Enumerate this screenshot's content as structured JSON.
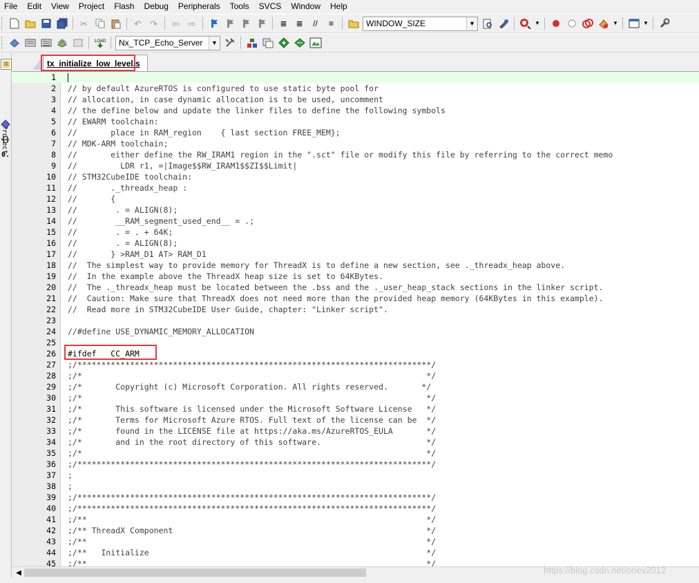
{
  "menu": [
    "File",
    "Edit",
    "View",
    "Project",
    "Flash",
    "Debug",
    "Peripherals",
    "Tools",
    "SVCS",
    "Window",
    "Help"
  ],
  "toolbar1": {
    "icons": [
      "new-file-icon",
      "open-folder-icon",
      "save-icon",
      "save-all-icon",
      "cut-icon",
      "copy-icon",
      "paste-icon",
      "undo-icon",
      "redo-icon",
      "nav-back-icon",
      "nav-forward-icon",
      "bookmark-icon",
      "bookmark-prev-icon",
      "bookmark-next-icon",
      "bookmark-clear-icon",
      "indent-icon",
      "unindent-icon",
      "comment-icon",
      "uncomment-icon",
      "find-in-files-icon"
    ],
    "find_combo_value": "WINDOW_SIZE",
    "icons_after": [
      "find-icon",
      "replace-icon",
      "debug-session-icon",
      "breakpoint-icon",
      "breakpoint-disabled-icon",
      "breakpoint-kill-icon",
      "breakpoint-options-icon",
      "window-layout-icon",
      "settings-wrench-icon"
    ]
  },
  "toolbar2": {
    "icons": [
      "translate-icon",
      "build-icon",
      "rebuild-icon",
      "batch-build-icon",
      "stop-build-icon",
      "download-icon"
    ],
    "target_combo_value": "Nx_TCP_Echo_Server",
    "icons_after": [
      "target-options-icon",
      "manage-components-icon",
      "select-packs-icon",
      "pack-installer-icon",
      "run-time-env-icon",
      "event-recorder-icon"
    ]
  },
  "leftpanel": {
    "label": "Project"
  },
  "tab": {
    "label": "tx_initialize_low_level.s"
  },
  "editor": {
    "lines": [
      {
        "n": "1",
        "t": ""
      },
      {
        "n": "2",
        "t": "// by default AzureRTOS is configured to use static byte pool for"
      },
      {
        "n": "3",
        "t": "// allocation, in case dynamic allocation is to be used, uncomment"
      },
      {
        "n": "4",
        "t": "// the define below and update the linker files to define the following symbols"
      },
      {
        "n": "5",
        "t": "// EWARM toolchain:"
      },
      {
        "n": "6",
        "t": "//       place in RAM_region    { last section FREE_MEM};"
      },
      {
        "n": "7",
        "t": "// MDK-ARM toolchain;"
      },
      {
        "n": "8",
        "t": "//       either define the RW_IRAM1 region in the \".sct\" file or modify this file by referring to the correct memo"
      },
      {
        "n": "9",
        "t": "//         LDR r1, =|Image$$RW_IRAM1$$ZI$$Limit|"
      },
      {
        "n": "10",
        "t": "// STM32CubeIDE toolchain:"
      },
      {
        "n": "11",
        "t": "//       ._threadx_heap :"
      },
      {
        "n": "12",
        "t": "//       {"
      },
      {
        "n": "13",
        "t": "//        . = ALIGN(8);"
      },
      {
        "n": "14",
        "t": "//        __RAM_segment_used_end__ = .;"
      },
      {
        "n": "15",
        "t": "//        . = . + 64K;"
      },
      {
        "n": "16",
        "t": "//        . = ALIGN(8);"
      },
      {
        "n": "17",
        "t": "//       } >RAM_D1 AT> RAM_D1"
      },
      {
        "n": "18",
        "t": "//  The simplest way to provide memory for ThreadX is to define a new section, see ._threadx_heap above."
      },
      {
        "n": "19",
        "t": "//  In the example above the ThreadX heap size is set to 64KBytes."
      },
      {
        "n": "20",
        "t": "//  The ._threadx_heap must be located between the .bss and the ._user_heap_stack sections in the linker script."
      },
      {
        "n": "21",
        "t": "//  Caution: Make sure that ThreadX does not need more than the provided heap memory (64KBytes in this example)."
      },
      {
        "n": "22",
        "t": "//  Read more in STM32CubeIDE User Guide, chapter: \"Linker script\"."
      },
      {
        "n": "23",
        "t": ""
      },
      {
        "n": "24",
        "t": "//#define USE_DYNAMIC_MEMORY_ALLOCATION"
      },
      {
        "n": "25",
        "t": ""
      },
      {
        "n": "26",
        "t": "#ifdef   CC_ARM"
      },
      {
        "n": "27",
        "t": ";/**************************************************************************/"
      },
      {
        "n": "28",
        "t": ";/*                                                                        */"
      },
      {
        "n": "29",
        "t": ";/*       Copyright (c) Microsoft Corporation. All rights reserved.       */"
      },
      {
        "n": "30",
        "t": ";/*                                                                        */"
      },
      {
        "n": "31",
        "t": ";/*       This software is licensed under the Microsoft Software License   */"
      },
      {
        "n": "32",
        "t": ";/*       Terms for Microsoft Azure RTOS. Full text of the license can be  */"
      },
      {
        "n": "33",
        "t": ";/*       found in the LICENSE file at https://aka.ms/AzureRTOS_EULA       */"
      },
      {
        "n": "34",
        "t": ";/*       and in the root directory of this software.                      */"
      },
      {
        "n": "35",
        "t": ";/*                                                                        */"
      },
      {
        "n": "36",
        "t": ";/**************************************************************************/"
      },
      {
        "n": "37",
        "t": ";"
      },
      {
        "n": "38",
        "t": ";"
      },
      {
        "n": "39",
        "t": ";/**************************************************************************/"
      },
      {
        "n": "40",
        "t": ";/**************************************************************************/"
      },
      {
        "n": "41",
        "t": ";/**                                                                       */"
      },
      {
        "n": "42",
        "t": ";/** ThreadX Component                                                     */"
      },
      {
        "n": "43",
        "t": ";/**                                                                       */"
      },
      {
        "n": "44",
        "t": ";/**   Initialize                                                          */"
      },
      {
        "n": "45",
        "t": ";/**                                                                       */"
      }
    ]
  },
  "watermark": "https://blog.csdn.net/onev2012",
  "colors": {
    "highlight_box": "#e53935",
    "current_line": "#e8ffe8",
    "gutter": "#ececec"
  }
}
